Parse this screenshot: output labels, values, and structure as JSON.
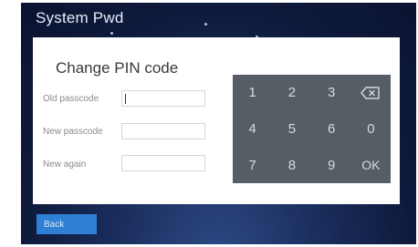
{
  "header": {
    "title": "System Pwd"
  },
  "dialog": {
    "title": "Change PIN code",
    "fields": [
      {
        "label": "Old passcode",
        "value": ""
      },
      {
        "label": "New passcode",
        "value": ""
      },
      {
        "label": "New again",
        "value": ""
      }
    ]
  },
  "keypad": {
    "keys": [
      "1",
      "2",
      "3",
      "backspace",
      "4",
      "5",
      "6",
      "0",
      "7",
      "8",
      "9",
      "OK"
    ]
  },
  "footer": {
    "back_label": "Back"
  },
  "colors": {
    "keypad_bg": "#565d65",
    "back_button": "#2f80d4",
    "screen_bg": "#13224a"
  }
}
